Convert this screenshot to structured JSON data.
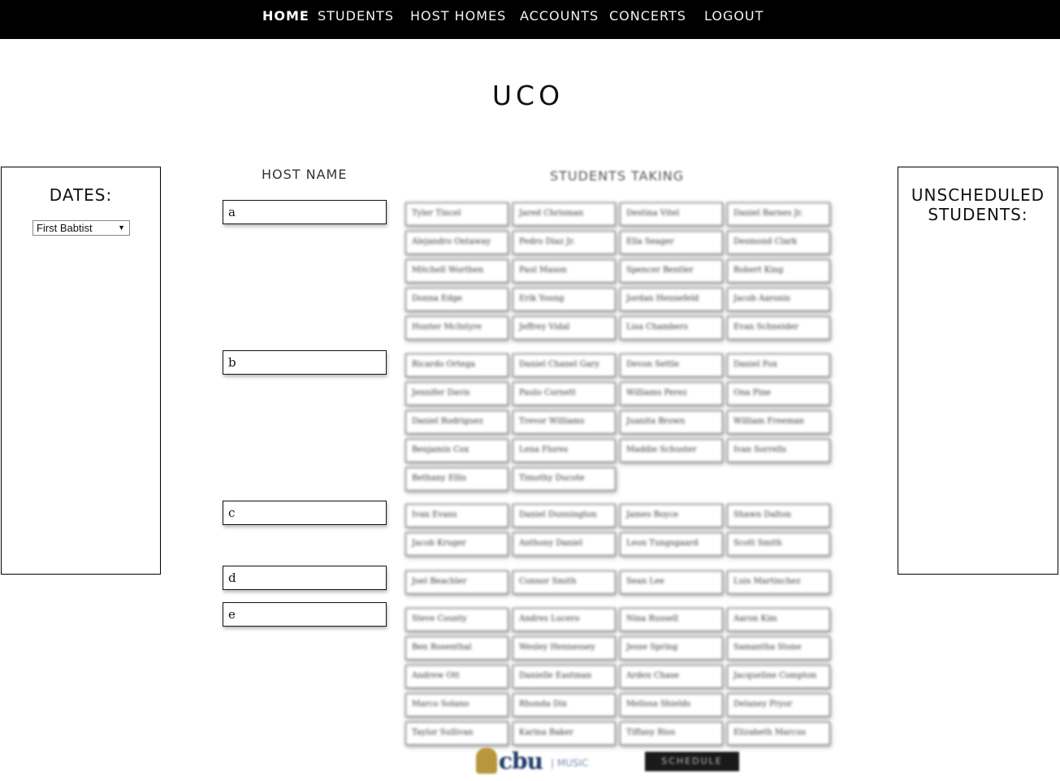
{
  "nav": {
    "home": "HOME",
    "students": "STUDENTS",
    "host_homes": "HOST HOMES",
    "accounts": "ACCOUNTS",
    "concerts": "CONCERTS",
    "logout": "LOGOUT"
  },
  "page_title": "UCO",
  "dates": {
    "label": "DATES:",
    "selected": "First Babtist"
  },
  "unscheduled": {
    "label_line1": "UNSCHEDULED",
    "label_line2": "STUDENTS:"
  },
  "headers": {
    "host_name": "HOST NAME",
    "students_taking": "STUDENTS TAKING"
  },
  "hosts": [
    {
      "name": "a",
      "students": [
        "Tyler Tincel",
        "Jared Chrisman",
        "Destina Vitel",
        "Daniel Barnes Jr.",
        "Alejandro Ontaway",
        "Pedro Diaz Jr.",
        "Ella Seager",
        "Desmond Clark",
        "Mitchell Worthen",
        "Paul Mason",
        "Spencer Bentler",
        "Robert King",
        "Donna Edge",
        "Erik Young",
        "Jordan Hennefeld",
        "Jacob Aaronis",
        "Hunter McIntyre",
        "Jeffrey Vidal",
        "Lisa Chambers",
        "Evan Schneider"
      ]
    },
    {
      "name": "b",
      "students": [
        "Ricardo Ortega",
        "Daniel Chanel Gary",
        "Devon Settle",
        "Daniel Fox",
        "Jennifer Davis",
        "Paulo Cornett",
        "Williams Perez",
        "Ona Pine",
        "Daniel Rodriguez",
        "Trevor Williams",
        "Juanita Brown",
        "William Freeman",
        "Benjamin Cox",
        "Lena Flores",
        "Maddie Schuster",
        "Ivan Sorrells",
        "Bethany Ellis",
        "Timothy Ducote"
      ]
    },
    {
      "name": "c",
      "students": [
        "Ivan Evans",
        "Daniel Dunnington",
        "James Boyce",
        "Shawn Dalton",
        "Jacob Kruger",
        "Anthony Daniel",
        "Leon Tungsgaard",
        "Scott Smith"
      ]
    },
    {
      "name": "d",
      "students": [
        "Joel Beachler",
        "Connor Smith",
        "Sean Lee",
        "Luis Martinchez"
      ]
    },
    {
      "name": "e",
      "students": [
        "Steve County",
        "Andres Lucero",
        "Nina Russell",
        "Aaron Kim",
        "Ben Rosenthal",
        "Wesley Hennessey",
        "Jesse Spring",
        "Samantha Stone",
        "Andrew Ott",
        "Danielle Eastman",
        "Arden Chase",
        "Jacqueline Compton",
        "Marco Solano",
        "Rhonda Dix",
        "Melissa Shields",
        "Delaney Pryor",
        "Taylor Sullivan",
        "Karina Baker",
        "Tiffany Rios",
        "Elizabeth Marcus"
      ]
    }
  ],
  "footer": {
    "logo_text": "cbu",
    "logo_sub": "| MUSIC",
    "schedule_button": "SCHEDULE"
  }
}
